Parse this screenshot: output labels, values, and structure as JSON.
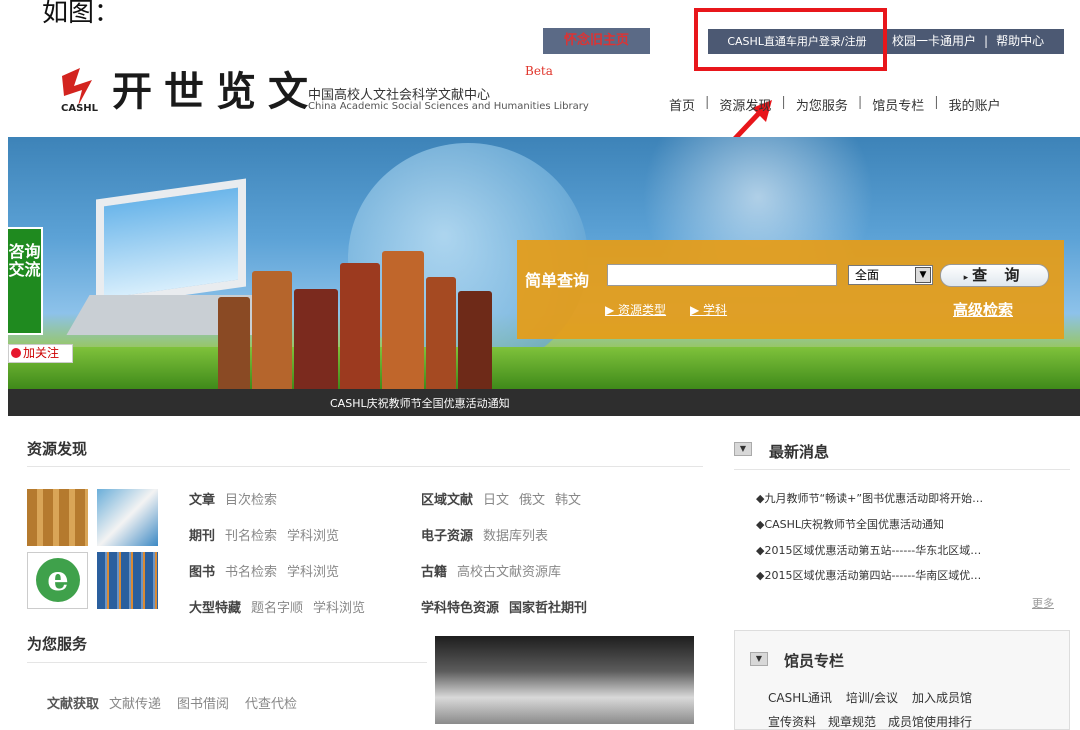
{
  "intro": "如图：",
  "top": {
    "nostalgia": "怀念旧主页",
    "login": "CASHL直通车用户登录/注册",
    "card": "校园一卡通用户",
    "sep": "|",
    "help": "帮助中心"
  },
  "logo": {
    "text": "开世览文",
    "cashl": "CASHL",
    "beta": "Beta",
    "center_cn": "中国高校人文社会科学文献中心",
    "center_en": "China Academic Social Sciences and Humanities Library"
  },
  "nav": {
    "items": [
      "首页",
      "资源发现",
      "为您服务",
      "馆员专栏",
      "我的账户"
    ],
    "sep": "|"
  },
  "sidebar": {
    "consult": "咨询交流",
    "follow_icon": "weibo-icon",
    "follow": "加关注"
  },
  "search": {
    "label": "简单查询",
    "value": "",
    "scope": "全面",
    "button": "查 询",
    "resource_type": "资源类型",
    "subject": "学科",
    "advanced": "高级检索",
    "panel_color": "#e69c16"
  },
  "announcement": "CASHL庆祝教师节全国优惠活动通知",
  "resources": {
    "title": "资源发现",
    "rows": [
      {
        "h": "文章",
        "links": [
          "目次检索"
        ],
        "h2": "区域文献",
        "links2": [
          "日文",
          "俄文",
          "韩文"
        ]
      },
      {
        "h": "期刊",
        "links": [
          "刊名检索",
          "学科浏览"
        ],
        "h2": "电子资源",
        "links2": [
          "数据库列表"
        ]
      },
      {
        "h": "图书",
        "links": [
          "书名检索",
          "学科浏览"
        ],
        "h2": "古籍",
        "links2": [
          "高校古文献资源库"
        ]
      },
      {
        "h": "大型特藏",
        "links": [
          "题名字顺",
          "学科浏览"
        ],
        "h2": "学科特色资源",
        "links2": [],
        "h3": "国家哲社期刊"
      }
    ]
  },
  "services": {
    "title": "为您服务",
    "head": "文献获取",
    "links": [
      "文献传递",
      "图书借阅",
      "代查代检"
    ]
  },
  "news": {
    "title": "最新消息",
    "items": [
      "◆九月教师节“畅读+”图书优惠活动即将开始…",
      "◆CASHL庆祝教师节全国优惠活动通知",
      "◆2015区域优惠活动第五站------华东北区域…",
      "◆2015区域优惠活动第四站------华南区域优…"
    ],
    "more": "更多"
  },
  "librarian": {
    "title": "馆员专栏",
    "row1": [
      "CASHL通讯",
      "培训/会议",
      "加入成员馆"
    ],
    "row2": [
      "宣传资料",
      "规章规范",
      "成员馆使用排行"
    ]
  },
  "colors": {
    "topbar": "#4c5973",
    "highlight": "#e8161b",
    "newsbar": "#2e2e2e",
    "consult": "#1f8a1f"
  }
}
